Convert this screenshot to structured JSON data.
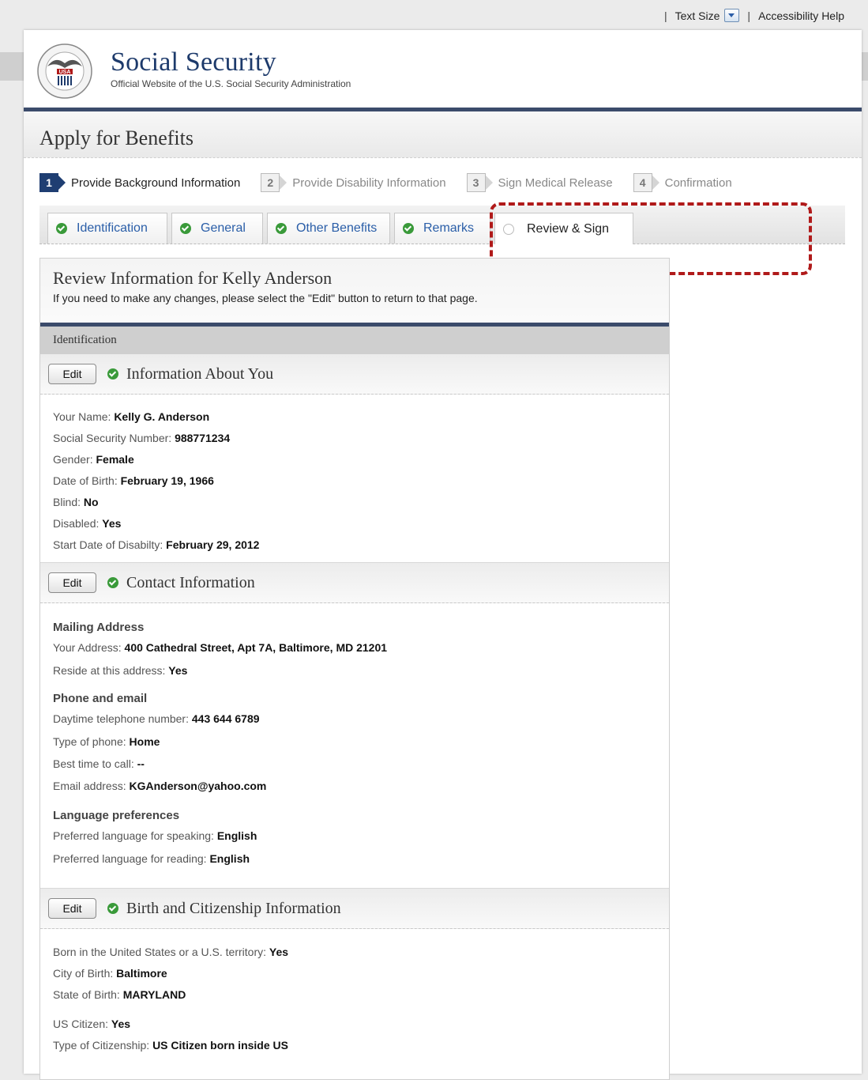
{
  "utility": {
    "separator": "|",
    "text_size": "Text Size",
    "accessibility": "Accessibility Help"
  },
  "header": {
    "agency": "Social Security",
    "tagline": "Official Website of the U.S. Social Security Administration",
    "seal_text": "USA"
  },
  "page_title": "Apply for Benefits",
  "steps": [
    {
      "num": "1",
      "label": "Provide Background Information",
      "active": true
    },
    {
      "num": "2",
      "label": "Provide Disability Information",
      "active": false
    },
    {
      "num": "3",
      "label": "Sign Medical Release",
      "active": false
    },
    {
      "num": "4",
      "label": "Confirmation",
      "active": false
    }
  ],
  "tabs": [
    {
      "label": "Identification",
      "complete": true
    },
    {
      "label": "General",
      "complete": true
    },
    {
      "label": "Other Benefits",
      "complete": true
    },
    {
      "label": "Remarks",
      "complete": true
    },
    {
      "label": "Review & Sign",
      "complete": false
    }
  ],
  "review": {
    "title": "Review Information for Kelly Anderson",
    "description": "If you need to make any changes, please select the \"Edit\" button to return to that page.",
    "group": "Identification",
    "edit_label": "Edit"
  },
  "about_you": {
    "title": "Information About You",
    "rows": [
      {
        "label": "Your Name:",
        "value": "Kelly G. Anderson"
      },
      {
        "label": "Social Security Number:",
        "value": "988771234"
      },
      {
        "label": "Gender:",
        "value": "Female"
      },
      {
        "label": "Date of Birth:",
        "value": "February 19, 1966"
      },
      {
        "label": "Blind:",
        "value": "No"
      },
      {
        "label": "Disabled:",
        "value": "Yes"
      },
      {
        "label": "Start Date of Disabilty:",
        "value": "February 29, 2012"
      }
    ]
  },
  "contact": {
    "title": "Contact Information",
    "mailing_heading": "Mailing Address",
    "mailing_rows": [
      {
        "label": "Your Address:",
        "value": "400 Cathedral Street, Apt 7A, Baltimore, MD 21201"
      },
      {
        "label": "Reside at this address:",
        "value": "Yes"
      }
    ],
    "phone_heading": "Phone and email",
    "phone_rows": [
      {
        "label": "Daytime telephone number:",
        "value": "443 644 6789"
      },
      {
        "label": "Type of phone:",
        "value": "Home"
      },
      {
        "label": "Best time to call:",
        "value": "--"
      },
      {
        "label": "Email address:",
        "value": "KGAnderson@yahoo.com"
      }
    ],
    "language_heading": "Language preferences",
    "language_rows": [
      {
        "label": "Preferred language for speaking:",
        "value": "English"
      },
      {
        "label": "Preferred language for reading:",
        "value": "English"
      }
    ]
  },
  "birth": {
    "title": "Birth and Citizenship Information",
    "rows": [
      {
        "label": "Born in the United States or a U.S. territory:",
        "value": "Yes"
      },
      {
        "label": "City of Birth:",
        "value": "Baltimore"
      },
      {
        "label": "State of Birth:",
        "value": "MARYLAND"
      }
    ],
    "rows2": [
      {
        "label": "US Citizen:",
        "value": "Yes"
      },
      {
        "label": "Type of Citizenship:",
        "value": "US Citizen born inside US"
      }
    ]
  }
}
